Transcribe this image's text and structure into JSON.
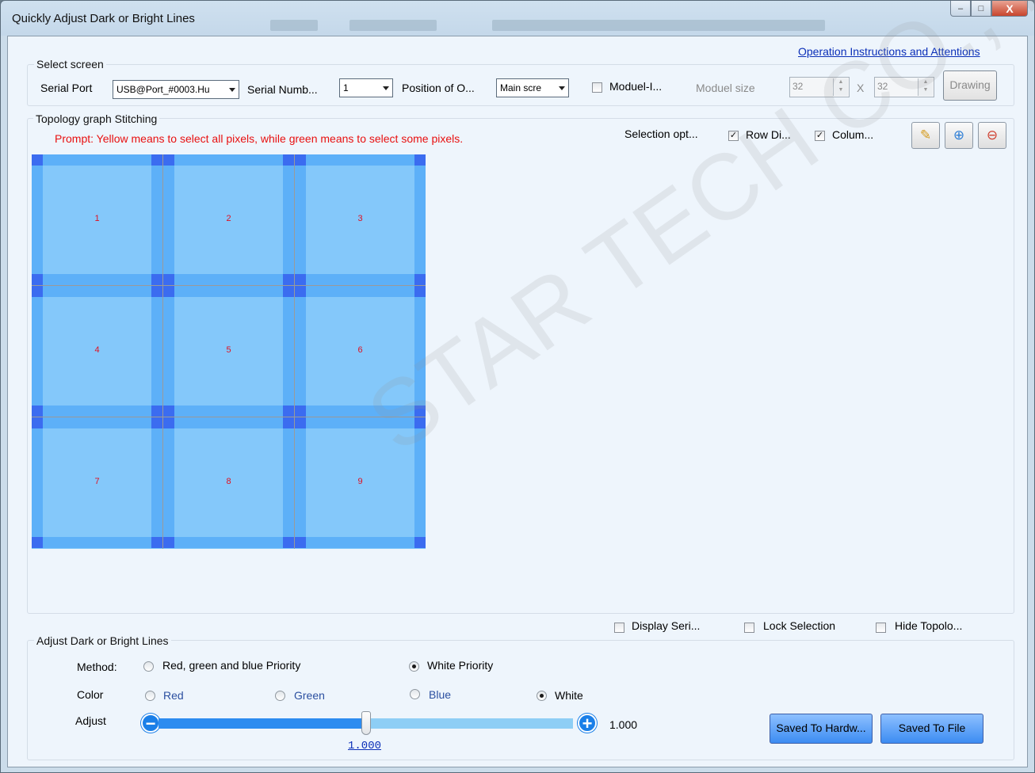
{
  "window": {
    "title": "Quickly Adjust Dark or Bright Lines"
  },
  "caption_buttons": {
    "minimize": "–",
    "maximize": "□",
    "close": "X"
  },
  "header": {
    "instructions_link": "Operation Instructions and Attentions"
  },
  "select_screen": {
    "group_label": "Select screen",
    "serial_port_label": "Serial Port",
    "serial_port_value": "USB@Port_#0003.Hu",
    "serial_number_label": "Serial Numb...",
    "serial_number_value": "1",
    "position_label": "Position of O...",
    "position_value": "Main scre",
    "module_checkbox_label": "Moduel-I...",
    "module_checked": false,
    "module_size_label": "Moduel size",
    "module_width": "32",
    "module_x": "X",
    "module_height": "32",
    "drawing_button": "Drawing"
  },
  "topology": {
    "group_label": "Topology graph Stitching",
    "prompt": "Prompt: Yellow means to select all pixels, while green means to select some pixels.",
    "selection_options_label": "Selection opt...",
    "row_label": "Row Di...",
    "row_checked": true,
    "column_label": "Colum...",
    "column_checked": true,
    "icons": [
      "brush-icon",
      "zoom-in-icon",
      "zoom-out-icon"
    ],
    "tiles": [
      "1",
      "2",
      "3",
      "4",
      "5",
      "6",
      "7",
      "8",
      "9"
    ]
  },
  "options_row": {
    "display_serial_label": "Display Seri...",
    "display_serial_checked": false,
    "lock_selection_label": "Lock Selection",
    "lock_selection_checked": false,
    "hide_topology_label": "Hide Topolo...",
    "hide_topology_checked": false
  },
  "adjust": {
    "group_label": "Adjust Dark or Bright Lines",
    "method_label": "Method:",
    "method_rgb_label": "Red, green and blue Priority",
    "method_white_label": "White Priority",
    "method_selected": "White Priority",
    "color_label": "Color",
    "colors": [
      "Red",
      "Green",
      "Blue",
      "White"
    ],
    "color_selected": "White",
    "adjust_label": "Adjust",
    "slider_value": 1.0,
    "slider_fraction": 0.5,
    "slider_value_text": "1.000",
    "slider_under_text": "1.000",
    "save_hardware_button": "Saved To Hardw...",
    "save_file_button": "Saved To File"
  },
  "watermark": "STAR TECH CO., L'",
  "colors": {
    "accent_blue": "#3c8cf2",
    "prompt_red": "#e81010",
    "tile_blue": "#84c8fa",
    "link_blue": "#0b2fb8"
  }
}
